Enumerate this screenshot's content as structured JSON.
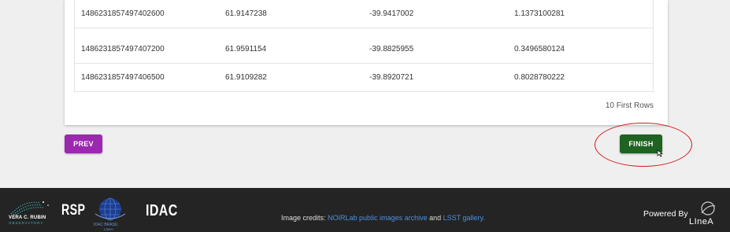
{
  "table": {
    "rows": [
      [
        "1486231857497402600",
        "61.9147238",
        "-39.9417002",
        "1.1373100281"
      ],
      [
        "1486231857497407200",
        "61.9591154",
        "-39.8825955",
        "0.3496580124"
      ],
      [
        "1486231857497406500",
        "61.9109282",
        "-39.8920721",
        "0.8028780222"
      ]
    ],
    "rows_note": "10 First Rows"
  },
  "buttons": {
    "prev": "PREV",
    "finish": "FINISH"
  },
  "footer": {
    "rubin_line1": "VERA C. RUBIN",
    "rubin_line2": "OBSERVATORY",
    "rsp": "RSP",
    "idac_brasil_line1": "IDAC BRASIL",
    "idac_brasil_line2": "LIneA",
    "idac": "IDAC",
    "credits_prefix": "Image credits: ",
    "credits_link1": "NOIRLab public images archive",
    "credits_and": " and ",
    "credits_link2": "LSST gallery.",
    "powered_by": "Powered By",
    "linea": "LIneA"
  },
  "colors": {
    "prev_button": "#9c27b0",
    "finish_button": "#1e6321",
    "highlight_ring": "#d11a1a",
    "footer_bg": "#242424",
    "link": "#4a90e2"
  }
}
